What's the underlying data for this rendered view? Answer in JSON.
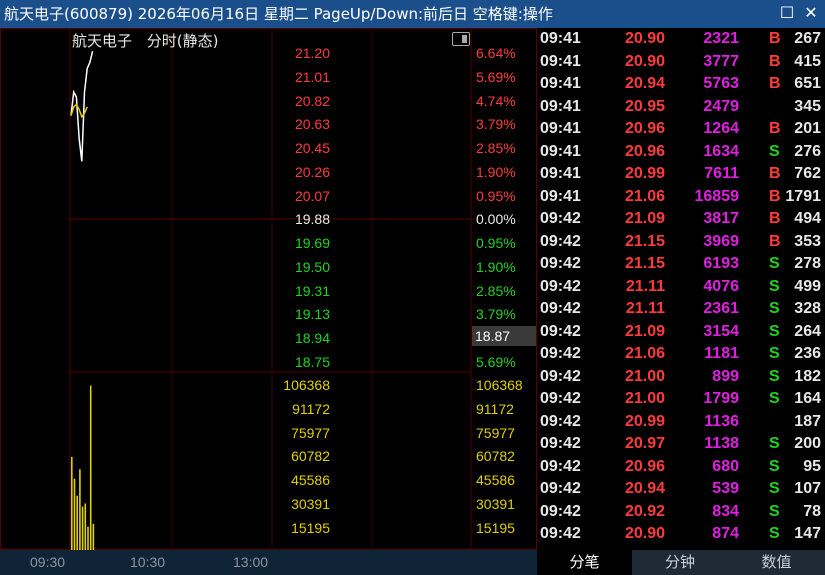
{
  "window": {
    "title": "航天电子(600879) 2026年06月16日 星期二 PageUp/Down:前后日 空格键:操作",
    "maximize_icon": "maximize-icon",
    "close_icon": "close-icon"
  },
  "chart": {
    "name": "航天电子",
    "mode": "分时(静态)",
    "current_price": "18.87",
    "price_labels": [
      "21.20",
      "21.01",
      "20.82",
      "20.63",
      "20.45",
      "20.26",
      "20.07",
      "19.88",
      "19.69",
      "19.50",
      "19.31",
      "19.13",
      "18.94",
      "18.75"
    ],
    "pct_labels": [
      "6.64%",
      "5.69%",
      "4.74%",
      "3.79%",
      "2.85%",
      "1.90%",
      "0.95%",
      "0.00%",
      "0.95%",
      "1.90%",
      "2.85%",
      "3.79%",
      "",
      "5.69%"
    ],
    "volume_labels": [
      "106368",
      "91172",
      "75977",
      "60782",
      "45586",
      "30391",
      "15195"
    ],
    "time_labels": [
      "09:30",
      "10:30",
      "13:00"
    ],
    "colors": {
      "up": "#ff3b3b",
      "down": "#21d321",
      "flat": "#eaeaea",
      "volume": "#e0d000",
      "grid": "#3a0000"
    },
    "chart_data": {
      "type": "line",
      "series": [
        {
          "values": [
            20.63,
            20.82,
            20.78,
            20.45,
            20.26,
            20.82,
            21.01,
            21.06,
            21.15
          ]
        },
        {
          "values": [
            20.63,
            20.7,
            20.72,
            20.68,
            20.62,
            20.65,
            20.7
          ]
        }
      ],
      "volume": [
        60000,
        46000,
        35000,
        52000,
        28000,
        30000,
        15000,
        106000,
        16859
      ],
      "ylim": [
        18.56,
        21.2
      ],
      "vol_ylim": [
        0,
        106368
      ]
    }
  },
  "trades": [
    {
      "time": "09:41",
      "price": "20.90",
      "vol": "2321",
      "dir": "B",
      "count": "267"
    },
    {
      "time": "09:41",
      "price": "20.90",
      "vol": "3777",
      "dir": "B",
      "count": "415"
    },
    {
      "time": "09:41",
      "price": "20.94",
      "vol": "5763",
      "dir": "B",
      "count": "651"
    },
    {
      "time": "09:41",
      "price": "20.95",
      "vol": "2479",
      "dir": "",
      "count": "345"
    },
    {
      "time": "09:41",
      "price": "20.96",
      "vol": "1264",
      "dir": "B",
      "count": "201"
    },
    {
      "time": "09:41",
      "price": "20.96",
      "vol": "1634",
      "dir": "S",
      "count": "276"
    },
    {
      "time": "09:41",
      "price": "20.99",
      "vol": "7611",
      "dir": "B",
      "count": "762"
    },
    {
      "time": "09:41",
      "price": "21.06",
      "vol": "16859",
      "dir": "B",
      "count": "1791"
    },
    {
      "time": "09:42",
      "price": "21.09",
      "vol": "3817",
      "dir": "B",
      "count": "494"
    },
    {
      "time": "09:42",
      "price": "21.15",
      "vol": "3969",
      "dir": "B",
      "count": "353"
    },
    {
      "time": "09:42",
      "price": "21.15",
      "vol": "6193",
      "dir": "S",
      "count": "278"
    },
    {
      "time": "09:42",
      "price": "21.11",
      "vol": "4076",
      "dir": "S",
      "count": "499"
    },
    {
      "time": "09:42",
      "price": "21.11",
      "vol": "2361",
      "dir": "S",
      "count": "328"
    },
    {
      "time": "09:42",
      "price": "21.09",
      "vol": "3154",
      "dir": "S",
      "count": "264"
    },
    {
      "time": "09:42",
      "price": "21.06",
      "vol": "1181",
      "dir": "S",
      "count": "236"
    },
    {
      "time": "09:42",
      "price": "21.00",
      "vol": "899",
      "dir": "S",
      "count": "182"
    },
    {
      "time": "09:42",
      "price": "21.00",
      "vol": "1799",
      "dir": "S",
      "count": "164"
    },
    {
      "time": "09:42",
      "price": "20.99",
      "vol": "1136",
      "dir": "",
      "count": "187"
    },
    {
      "time": "09:42",
      "price": "20.97",
      "vol": "1138",
      "dir": "S",
      "count": "200"
    },
    {
      "time": "09:42",
      "price": "20.96",
      "vol": "680",
      "dir": "S",
      "count": "95"
    },
    {
      "time": "09:42",
      "price": "20.94",
      "vol": "539",
      "dir": "S",
      "count": "107"
    },
    {
      "time": "09:42",
      "price": "20.92",
      "vol": "834",
      "dir": "S",
      "count": "78"
    },
    {
      "time": "09:42",
      "price": "20.90",
      "vol": "874",
      "dir": "S",
      "count": "147"
    }
  ],
  "tabs": [
    "分笔",
    "分钟",
    "数值"
  ]
}
